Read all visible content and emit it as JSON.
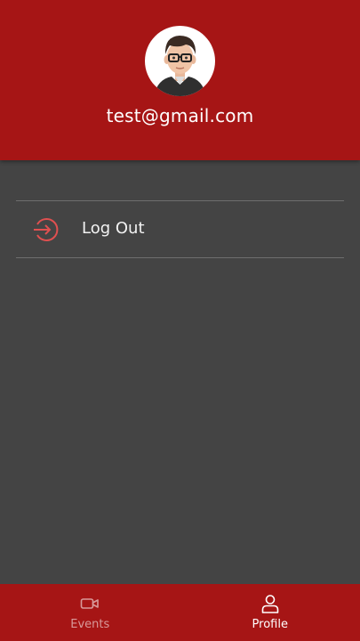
{
  "profile": {
    "email": "test@gmail.com",
    "avatar_icon": "avatar-icon"
  },
  "menu": {
    "logout_label": "Log Out",
    "logout_icon": "logout-icon",
    "accent_color": "#e05050"
  },
  "bottom_nav": {
    "items": [
      {
        "label": "Events",
        "icon": "video-camera-icon",
        "active": false
      },
      {
        "label": "Profile",
        "icon": "user-icon",
        "active": true
      }
    ]
  },
  "colors": {
    "brand": "#a61515",
    "background": "#444444"
  }
}
